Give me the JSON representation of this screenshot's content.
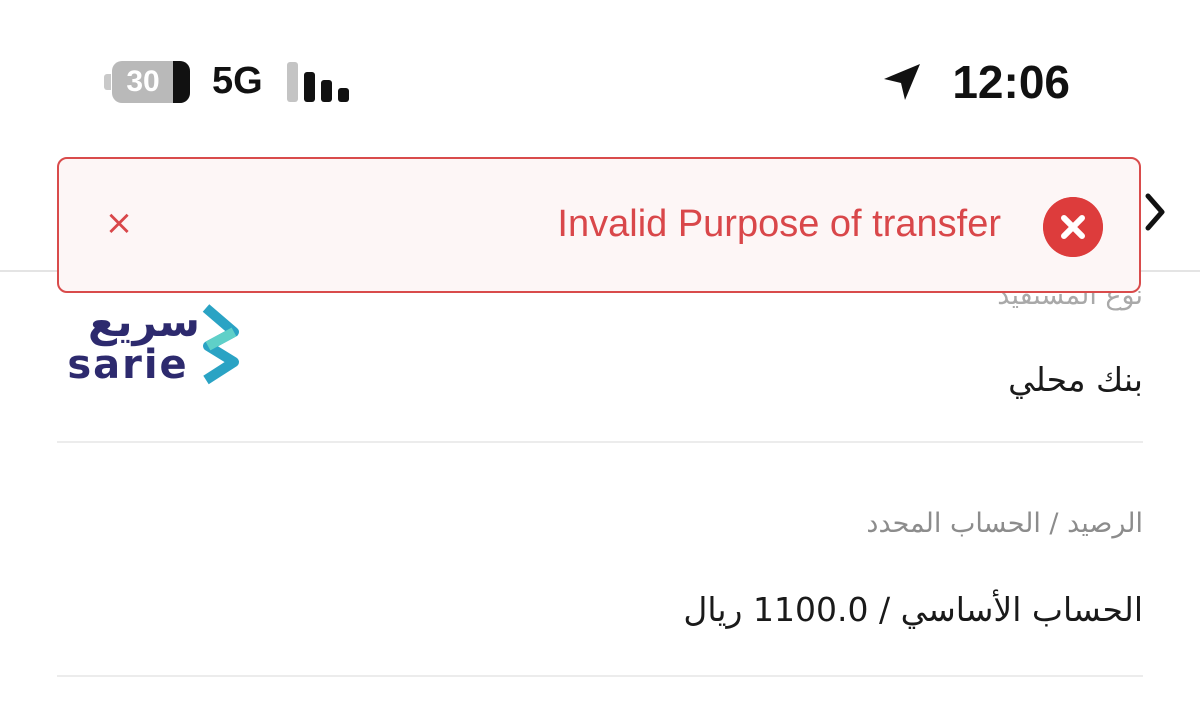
{
  "status_bar": {
    "battery_level": "30",
    "network": "5G",
    "time": "12:06",
    "icons": [
      "battery-icon",
      "signal-bars-icon",
      "location-arrow-icon"
    ]
  },
  "toast": {
    "message": "Invalid Purpose of transfer",
    "close_glyph": "×",
    "icons": [
      "close-icon",
      "error-circle-icon"
    ],
    "color": "#d9474a"
  },
  "header": {
    "back_icon": "chevron-right-icon"
  },
  "logo": {
    "arabic": "سريع",
    "latin": "sarie"
  },
  "beneficiary_type": {
    "label": "نوع المستفيد",
    "value": "بنك محلي"
  },
  "account": {
    "label": "الرصيد / الحساب المحدد",
    "value": "الحساب الأساسي / 1100.0 ريال"
  }
}
